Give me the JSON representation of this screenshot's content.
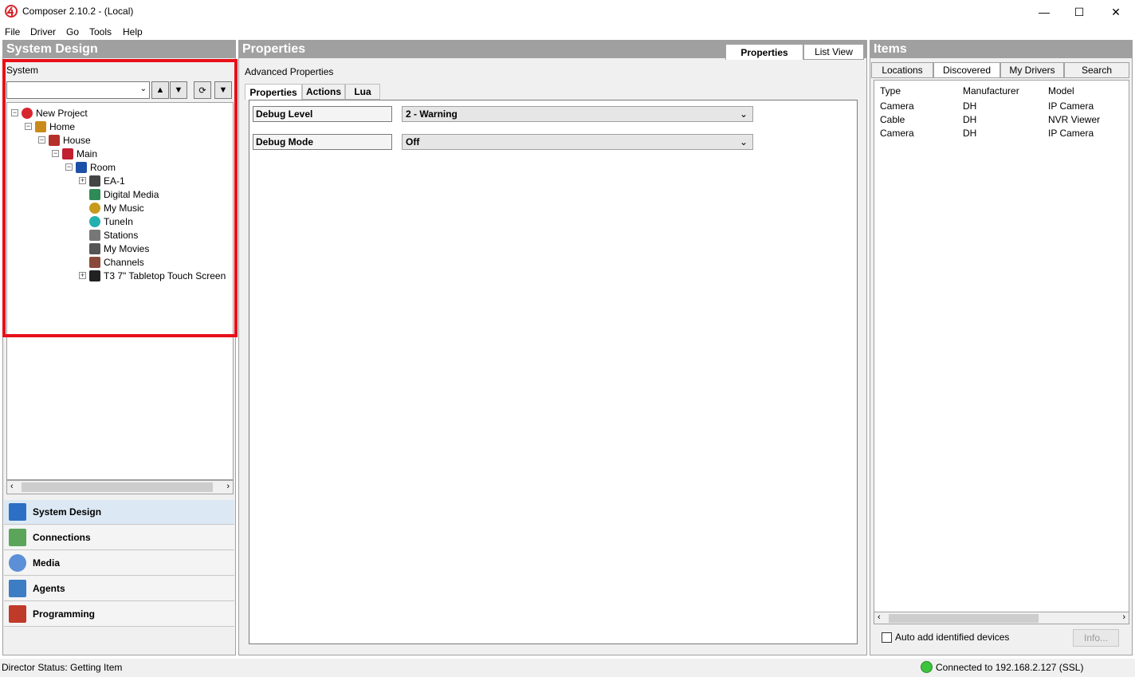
{
  "window": {
    "title": "Composer 2.10.2 - (Local)",
    "minimize": "—",
    "maximize": "☐",
    "close": "✕"
  },
  "menu": [
    "File",
    "Driver",
    "Go",
    "Tools",
    "Help"
  ],
  "left_pane": {
    "header": "System Design",
    "system_label": "System",
    "tree": [
      {
        "label": "New Project",
        "icon": "project-logo-icon",
        "color": "#d7262e"
      },
      {
        "label": "Home",
        "icon": "home-icon",
        "color": "#c98a1a"
      },
      {
        "label": "House",
        "icon": "house-icon",
        "color": "#b5302a"
      },
      {
        "label": "Main",
        "icon": "floor-icon",
        "color": "#c02030"
      },
      {
        "label": "Room",
        "icon": "room-shield-icon",
        "color": "#1c4fa8"
      },
      {
        "label": "EA-1",
        "icon": "controller-icon",
        "color": "#444444"
      },
      {
        "label": "Digital Media",
        "icon": "digital-media-icon",
        "color": "#2e8b57"
      },
      {
        "label": "My Music",
        "icon": "music-icon",
        "color": "#c79a1e"
      },
      {
        "label": "TuneIn",
        "icon": "tunein-icon",
        "color": "#25b0b0"
      },
      {
        "label": "Stations",
        "icon": "radio-icon",
        "color": "#777777"
      },
      {
        "label": "My Movies",
        "icon": "movies-icon",
        "color": "#555555"
      },
      {
        "label": "Channels",
        "icon": "channels-icon",
        "color": "#8a4a3a"
      },
      {
        "label": "T3 7\" Tabletop Touch Screen",
        "icon": "touchscreen-icon",
        "color": "#222222"
      }
    ],
    "nav": [
      {
        "label": "System Design",
        "icon": "system-design-icon",
        "color": "#2d6fc4"
      },
      {
        "label": "Connections",
        "icon": "connections-icon",
        "color": "#5aa55a"
      },
      {
        "label": "Media",
        "icon": "media-disc-icon",
        "color": "#5b8fd6"
      },
      {
        "label": "Agents",
        "icon": "agents-icon",
        "color": "#3c7dc4"
      },
      {
        "label": "Programming",
        "icon": "programming-icon",
        "color": "#c03a2a"
      }
    ]
  },
  "mid_pane": {
    "header": "Properties",
    "tabs": [
      "Properties",
      "List View"
    ],
    "advanced_label": "Advanced Properties",
    "subtabs": [
      "Properties",
      "Actions",
      "Lua"
    ],
    "properties": [
      {
        "label": "Debug Level",
        "value": "2 - Warning"
      },
      {
        "label": "Debug Mode",
        "value": "Off"
      }
    ]
  },
  "right_pane": {
    "header": "Items",
    "tabs": [
      "Locations",
      "Discovered",
      "My Drivers",
      "Search"
    ],
    "columns": [
      "Type",
      "Manufacturer",
      "Model"
    ],
    "rows": [
      [
        "Camera",
        "DH",
        "IP Camera"
      ],
      [
        "Cable",
        "DH",
        "NVR Viewer"
      ],
      [
        "Camera",
        "DH",
        "IP Camera"
      ]
    ],
    "auto_add_label": "Auto add identified devices",
    "info_button": "Info..."
  },
  "status": {
    "left": "Director Status: Getting Item",
    "right": "Connected to 192.168.2.127 (SSL)",
    "connected_color": "#3cc43c"
  },
  "accent": "#e8101a"
}
